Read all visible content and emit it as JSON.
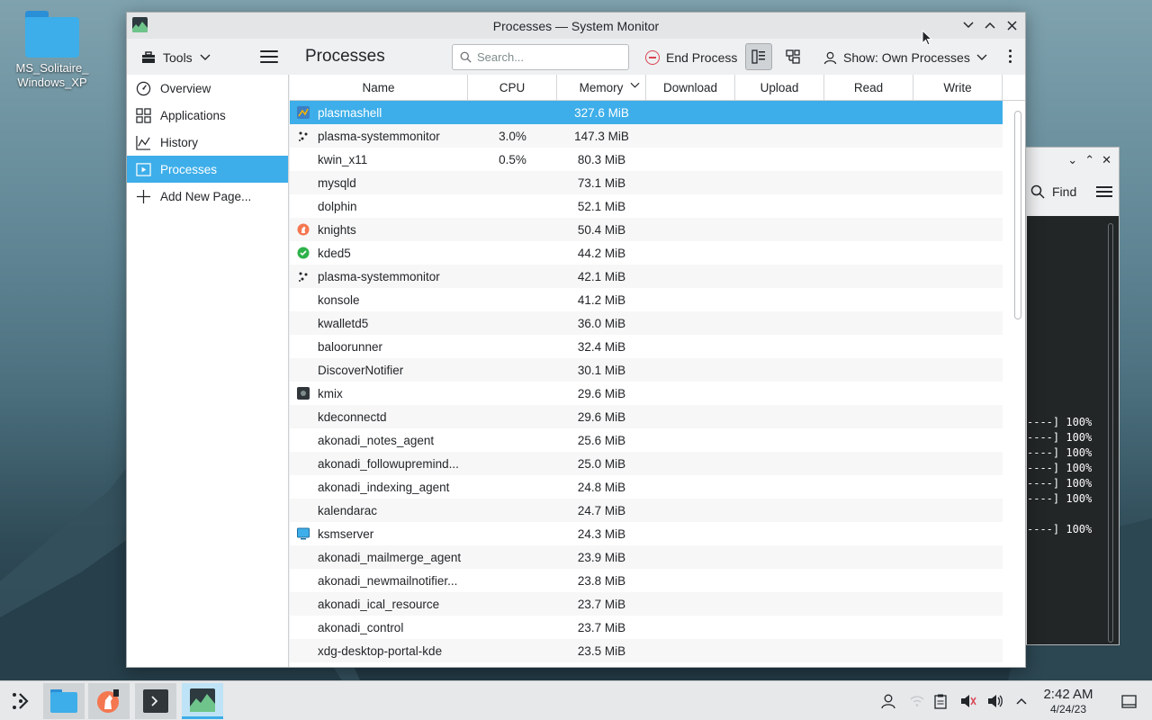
{
  "desktop": {
    "icon_label": "MS_Solitaire_ Windows_XP"
  },
  "back_window": {
    "find_label": "Find",
    "terminal_lines": [
      "----] 100%",
      "----] 100%",
      "----] 100%",
      "----] 100%",
      "----] 100%",
      "----] 100%",
      "----] 100%"
    ]
  },
  "window": {
    "title": "Processes — System Monitor",
    "toolbar": {
      "tools_label": "Tools",
      "page_title": "Processes",
      "search_placeholder": "Search...",
      "end_process_label": "End Process",
      "show_label": "Show: Own Processes"
    },
    "sidebar": {
      "items": [
        {
          "label": "Overview",
          "icon": "gauge-icon"
        },
        {
          "label": "Applications",
          "icon": "grid-icon"
        },
        {
          "label": "History",
          "icon": "chart-icon"
        },
        {
          "label": "Processes",
          "icon": "processes-icon",
          "active": true
        },
        {
          "label": "Add New Page...",
          "icon": "plus-icon"
        }
      ]
    },
    "table": {
      "columns": [
        "Name",
        "CPU",
        "Memory",
        "Download",
        "Upload",
        "Read",
        "Write"
      ],
      "rows": [
        {
          "name": "plasmashell",
          "cpu": "",
          "memory": "327.6 MiB",
          "icon": "plasma-icon",
          "selected": true
        },
        {
          "name": "plasma-systemmonitor",
          "cpu": "3.0%",
          "memory": "147.3 MiB",
          "icon": "sysmon-icon"
        },
        {
          "name": "kwin_x11",
          "cpu": "0.5%",
          "memory": "80.3 MiB",
          "icon": ""
        },
        {
          "name": "mysqld",
          "cpu": "",
          "memory": "73.1 MiB",
          "icon": ""
        },
        {
          "name": "dolphin",
          "cpu": "",
          "memory": "52.1 MiB",
          "icon": ""
        },
        {
          "name": "knights",
          "cpu": "",
          "memory": "50.4 MiB",
          "icon": "knights-icon"
        },
        {
          "name": "kded5",
          "cpu": "",
          "memory": "44.2 MiB",
          "icon": "kded-icon"
        },
        {
          "name": "plasma-systemmonitor",
          "cpu": "",
          "memory": "42.1 MiB",
          "icon": "sysmon-icon"
        },
        {
          "name": "konsole",
          "cpu": "",
          "memory": "41.2 MiB",
          "icon": ""
        },
        {
          "name": "kwalletd5",
          "cpu": "",
          "memory": "36.0 MiB",
          "icon": ""
        },
        {
          "name": "baloorunner",
          "cpu": "",
          "memory": "32.4 MiB",
          "icon": ""
        },
        {
          "name": "DiscoverNotifier",
          "cpu": "",
          "memory": "30.1 MiB",
          "icon": ""
        },
        {
          "name": "kmix",
          "cpu": "",
          "memory": "29.6 MiB",
          "icon": "kmix-icon"
        },
        {
          "name": "kdeconnectd",
          "cpu": "",
          "memory": "29.6 MiB",
          "icon": ""
        },
        {
          "name": "akonadi_notes_agent",
          "cpu": "",
          "memory": "25.6 MiB",
          "icon": ""
        },
        {
          "name": "akonadi_followupremind...",
          "cpu": "",
          "memory": "25.0 MiB",
          "icon": ""
        },
        {
          "name": "akonadi_indexing_agent",
          "cpu": "",
          "memory": "24.8 MiB",
          "icon": ""
        },
        {
          "name": "kalendarac",
          "cpu": "",
          "memory": "24.7 MiB",
          "icon": ""
        },
        {
          "name": "ksmserver",
          "cpu": "",
          "memory": "24.3 MiB",
          "icon": "ksmserver-icon"
        },
        {
          "name": "akonadi_mailmerge_agent",
          "cpu": "",
          "memory": "23.9 MiB",
          "icon": ""
        },
        {
          "name": "akonadi_newmailnotifier...",
          "cpu": "",
          "memory": "23.8 MiB",
          "icon": ""
        },
        {
          "name": "akonadi_ical_resource",
          "cpu": "",
          "memory": "23.7 MiB",
          "icon": ""
        },
        {
          "name": "akonadi_control",
          "cpu": "",
          "memory": "23.7 MiB",
          "icon": ""
        },
        {
          "name": "xdg-desktop-portal-kde",
          "cpu": "",
          "memory": "23.5 MiB",
          "icon": ""
        }
      ]
    }
  },
  "taskbar": {
    "time": "2:42 AM",
    "date": "4/24/23"
  },
  "colors": {
    "accent": "#3daee9",
    "danger": "#da4453",
    "window_bg": "#eff0f1"
  }
}
